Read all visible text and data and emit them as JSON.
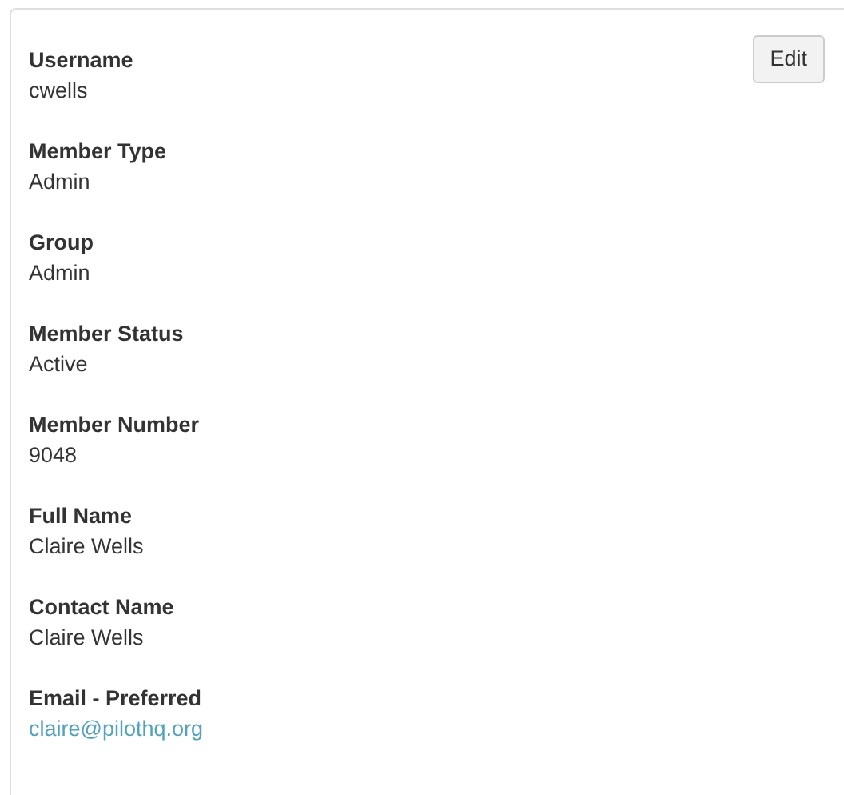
{
  "edit_button": "Edit",
  "fields": [
    {
      "label": "Username",
      "value": "cwells",
      "kind": "text"
    },
    {
      "label": "Member Type",
      "value": "Admin",
      "kind": "text"
    },
    {
      "label": "Group",
      "value": "Admin",
      "kind": "text"
    },
    {
      "label": "Member Status",
      "value": "Active",
      "kind": "text"
    },
    {
      "label": "Member Number",
      "value": "9048",
      "kind": "text"
    },
    {
      "label": "Full Name",
      "value": "Claire Wells",
      "kind": "text"
    },
    {
      "label": "Contact Name",
      "value": "Claire Wells",
      "kind": "text"
    },
    {
      "label": "Email - Preferred",
      "value": "claire@pilothq.org",
      "kind": "link"
    }
  ]
}
